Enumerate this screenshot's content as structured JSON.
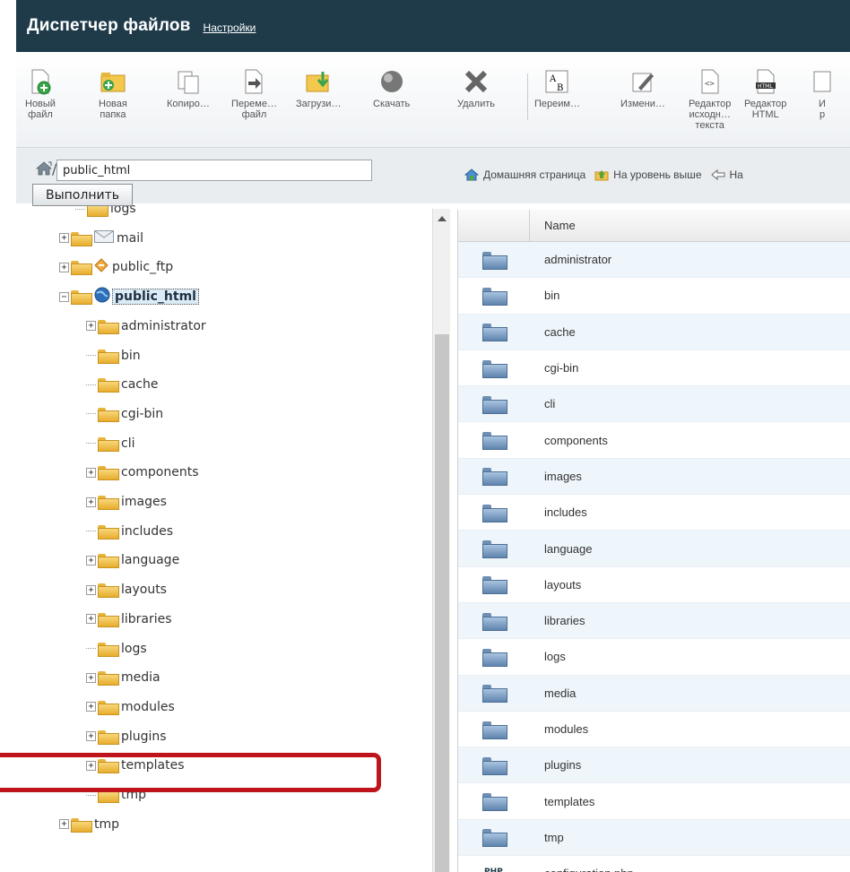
{
  "header": {
    "title": "Диспетчер файлов",
    "settings_link": "Настройки"
  },
  "toolbar": [
    {
      "label": "Новый\nфайл",
      "icon": "new-file-icon"
    },
    {
      "label": "Новая\nпапка",
      "icon": "new-folder-icon"
    },
    {
      "label": "Копиро…",
      "icon": "copy-icon"
    },
    {
      "label": "Переме…\nфайл",
      "icon": "move-icon"
    },
    {
      "label": "Загрузи…",
      "icon": "upload-icon"
    },
    {
      "label": "Скачать",
      "icon": "download-icon"
    },
    {
      "label": "Удалить",
      "icon": "delete-icon"
    },
    {
      "label": "Переим…",
      "icon": "rename-icon"
    },
    {
      "label": "Измени…",
      "icon": "edit-icon"
    },
    {
      "label": "Редактор\nисходн…\nтекста",
      "icon": "source-editor-icon"
    },
    {
      "label": "Редактор\nHTML",
      "icon": "html-editor-icon"
    },
    {
      "label": "И\nр",
      "icon": "more-icon"
    }
  ],
  "path": {
    "value": "public_html",
    "go_button": "Выполнить"
  },
  "nav": {
    "home": "Домашняя страница",
    "up": "На уровень выше",
    "back": "На"
  },
  "tree": [
    {
      "label": "logs",
      "exp": "",
      "partial": true
    },
    {
      "label": "mail",
      "exp": "+"
    },
    {
      "label": "public_ftp",
      "exp": "+"
    },
    {
      "label": "public_html",
      "exp": "-",
      "selected": true
    },
    {
      "label": "administrator",
      "exp": "+"
    },
    {
      "label": "bin",
      "exp": ""
    },
    {
      "label": "cache",
      "exp": ""
    },
    {
      "label": "cgi-bin",
      "exp": ""
    },
    {
      "label": "cli",
      "exp": ""
    },
    {
      "label": "components",
      "exp": "+"
    },
    {
      "label": "images",
      "exp": "+"
    },
    {
      "label": "includes",
      "exp": ""
    },
    {
      "label": "language",
      "exp": "+"
    },
    {
      "label": "layouts",
      "exp": "+"
    },
    {
      "label": "libraries",
      "exp": "+"
    },
    {
      "label": "logs",
      "exp": ""
    },
    {
      "label": "media",
      "exp": "+"
    },
    {
      "label": "modules",
      "exp": "+"
    },
    {
      "label": "plugins",
      "exp": "+"
    },
    {
      "label": "templates",
      "exp": "+"
    },
    {
      "label": "tmp",
      "exp": ""
    },
    {
      "label": "tmp",
      "exp": "+"
    }
  ],
  "table": {
    "header_name": "Name",
    "rows": [
      "administrator",
      "bin",
      "cache",
      "cgi-bin",
      "cli",
      "components",
      "images",
      "includes",
      "language",
      "layouts",
      "libraries",
      "logs",
      "media",
      "modules",
      "plugins",
      "templates",
      "tmp",
      "configuration.php"
    ],
    "file_icon_text": "PHP"
  },
  "colors": {
    "header_bg": "#1f3b4a",
    "highlight": "#c0141c",
    "row_alt": "#eef5fb"
  }
}
